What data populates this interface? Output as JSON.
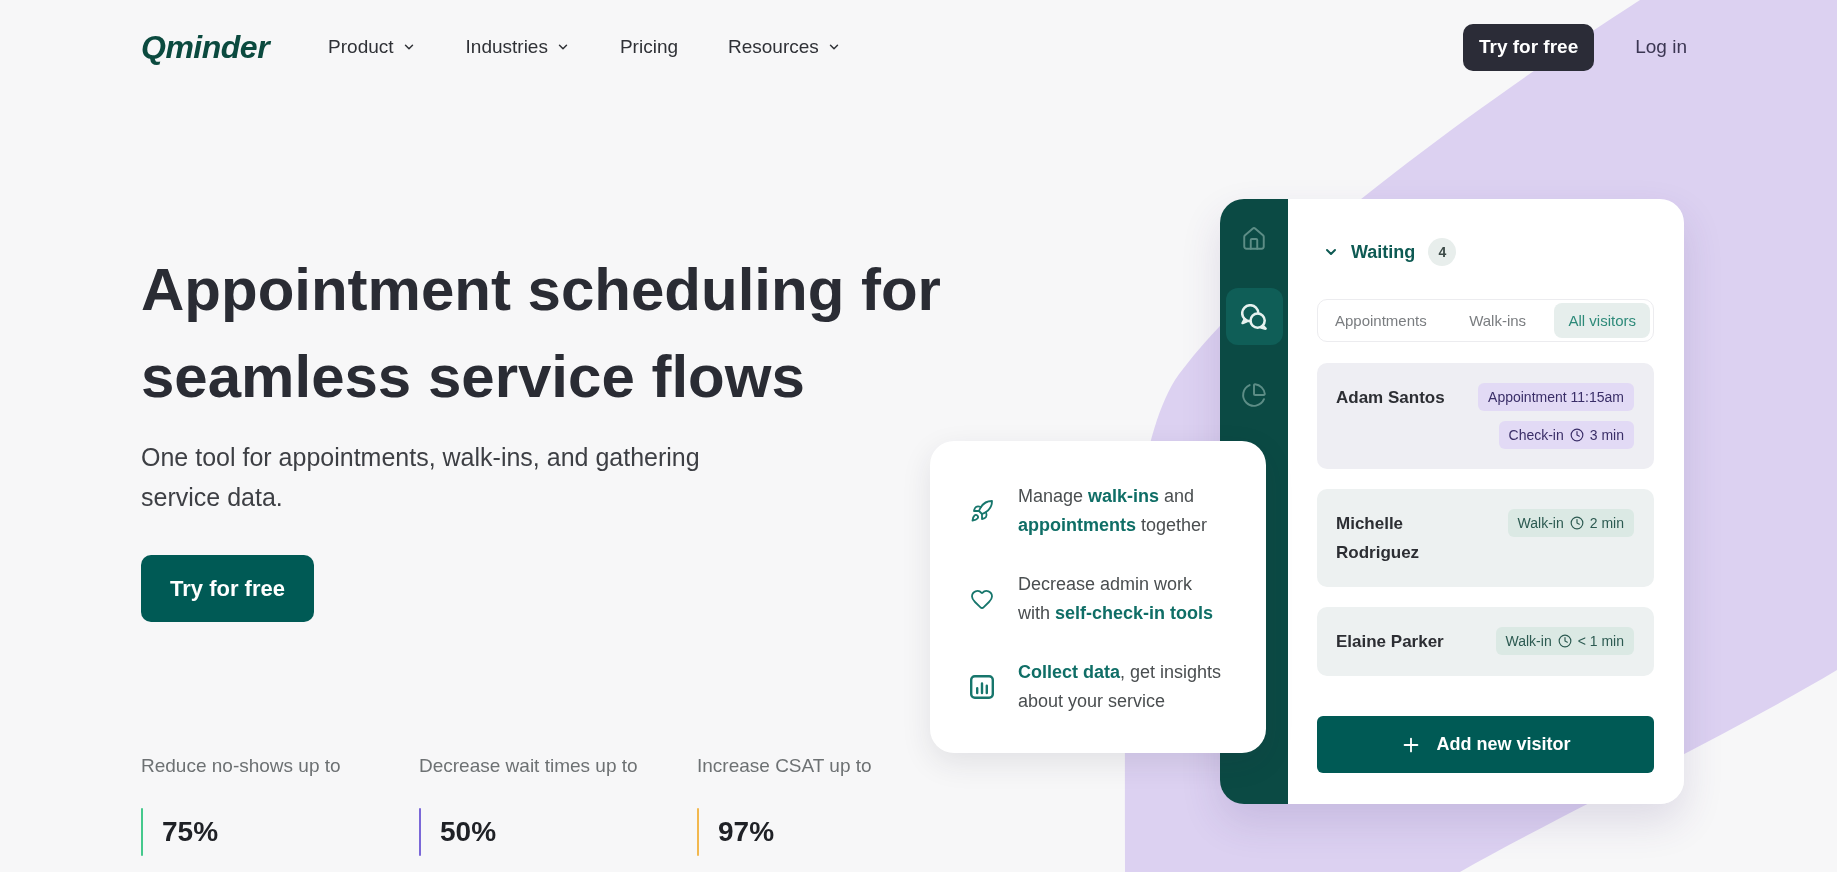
{
  "header": {
    "logo": "Qminder",
    "nav": [
      {
        "label": "Product",
        "dropdown": true
      },
      {
        "label": "Industries",
        "dropdown": true
      },
      {
        "label": "Pricing",
        "dropdown": false
      },
      {
        "label": "Resources",
        "dropdown": true
      }
    ],
    "cta": "Try for free",
    "login": "Log in"
  },
  "hero": {
    "title": "Appointment scheduling for seamless service flows",
    "subtitle": "One tool for appointments, walk-ins, and gathering service data.",
    "cta": "Try for free"
  },
  "stats": [
    {
      "label": "Reduce no-shows up to",
      "value": "75%",
      "color": "#45c98d"
    },
    {
      "label": "Decrease wait times up to",
      "value": "50%",
      "color": "#7b68d8"
    },
    {
      "label": "Increase CSAT up to",
      "value": "97%",
      "color": "#f2b84f"
    }
  ],
  "features": [
    {
      "text": "Manage **walk-ins** and **appointments** together"
    },
    {
      "text": "Decrease admin work with **self-check-in tools**"
    },
    {
      "text": "**Collect data**, get insights about your service"
    }
  ],
  "app": {
    "sidebar": [
      {
        "selected": false
      },
      {
        "selected": true
      },
      {
        "selected": false
      }
    ],
    "queue": {
      "title": "Waiting",
      "count": "4",
      "expanded": true
    },
    "tabs": [
      {
        "label": "Appointments",
        "selected": false
      },
      {
        "label": "Walk-ins",
        "selected": false
      },
      {
        "label": "All visitors",
        "selected": true
      }
    ],
    "visitors": [
      {
        "name": "Adam Santos",
        "kind": "appointment",
        "tags": [
          {
            "label": "Appointment 11:15am"
          },
          {
            "label": "Check-in",
            "time": "3 min"
          }
        ]
      },
      {
        "name": "Michelle Rodriguez",
        "kind": "walkin",
        "tags": [
          {
            "label": "Walk-in",
            "time": "2 min"
          }
        ]
      },
      {
        "name": "Elaine Parker",
        "kind": "walkin",
        "tags": [
          {
            "label": "Walk-in",
            "time": "< 1 min"
          }
        ]
      }
    ],
    "add_button": "Add new visitor"
  }
}
